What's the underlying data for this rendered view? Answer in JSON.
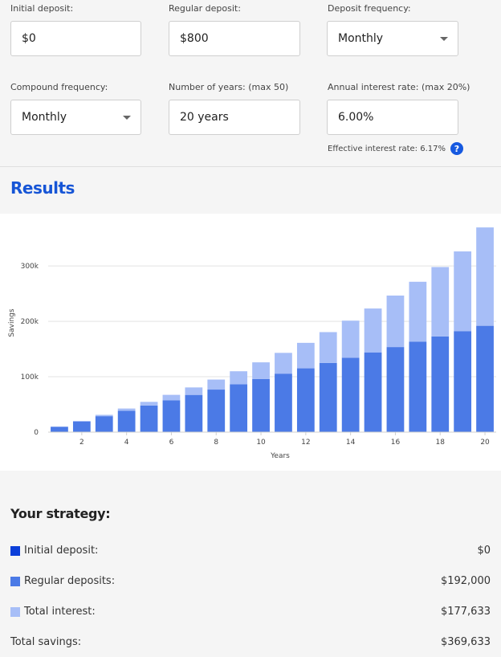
{
  "inputs": {
    "initial_deposit": {
      "label": "Initial deposit:",
      "value": "$0"
    },
    "regular_deposit": {
      "label": "Regular deposit:",
      "value": "$800"
    },
    "deposit_frequency": {
      "label": "Deposit frequency:",
      "value": "Monthly"
    },
    "compound_frequency": {
      "label": "Compound frequency:",
      "value": "Monthly"
    },
    "years": {
      "label": "Number of years: (max 50)",
      "value": "20 years"
    },
    "interest_rate": {
      "label": "Annual interest rate: (max 20%)",
      "value": "6.00%"
    },
    "effective_rate": "Effective interest rate: 6.17%",
    "help_glyph": "?"
  },
  "results": {
    "title": "Results"
  },
  "chart_data": {
    "type": "bar",
    "stacked": true,
    "xlabel": "Years",
    "ylabel": "Savings",
    "x": [
      1,
      2,
      3,
      4,
      5,
      6,
      7,
      8,
      9,
      10,
      11,
      12,
      13,
      14,
      15,
      16,
      17,
      18,
      19,
      20
    ],
    "x_tick_labels": [
      "2",
      "4",
      "6",
      "8",
      "10",
      "12",
      "14",
      "16",
      "18",
      "20"
    ],
    "y_ticks": [
      0,
      100000,
      200000,
      300000
    ],
    "y_tick_labels": [
      "0",
      "100k",
      "200k",
      "300k"
    ],
    "ylim": [
      0,
      380000
    ],
    "grid": true,
    "series": [
      {
        "values": [
          9600,
          19200,
          28800,
          38400,
          48000,
          57600,
          67200,
          76800,
          86400,
          96000,
          105600,
          115200,
          124800,
          134400,
          144000,
          153600,
          163200,
          172800,
          182400,
          192000
        ],
        "color": "#4b7ae6"
      },
      {
        "values": [
          300,
          1100,
          2400,
          4200,
          6600,
          9700,
          13500,
          18100,
          23500,
          30000,
          37500,
          46000,
          55800,
          66900,
          79200,
          93000,
          108300,
          125300,
          143900,
          177633
        ],
        "color": "#a7bef7"
      }
    ]
  },
  "strategy": {
    "title": "Your strategy:",
    "rows": [
      {
        "label": "Initial deposit:",
        "value": "$0",
        "color": "#0b3fd9"
      },
      {
        "label": "Regular deposits:",
        "value": "$192,000",
        "color": "#4b7ae6"
      },
      {
        "label": "Total interest:",
        "value": "$177,633",
        "color": "#a7bef7"
      },
      {
        "label": "Total savings:",
        "value": "$369,633"
      }
    ]
  }
}
